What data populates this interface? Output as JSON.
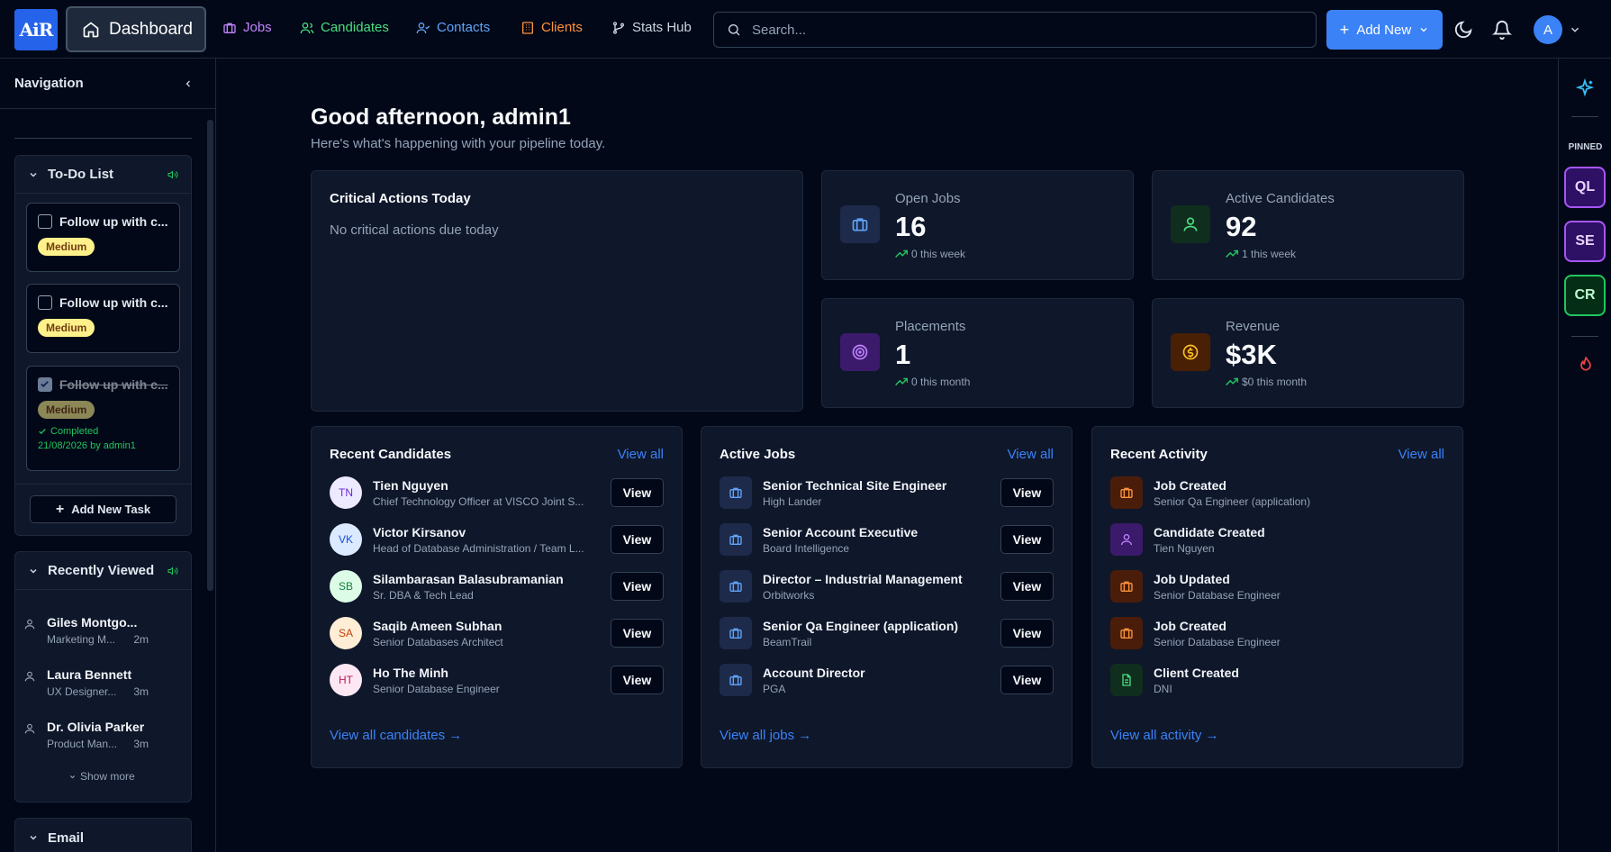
{
  "topbar": {
    "logo": "AiR",
    "dashboard": "Dashboard",
    "nav": [
      {
        "label": "Jobs",
        "color": "#c084fc"
      },
      {
        "label": "Candidates",
        "color": "#4ade80"
      },
      {
        "label": "Contacts",
        "color": "#60a5fa"
      },
      {
        "label": "Clients",
        "color": "#fb923c"
      },
      {
        "label": "Stats Hub",
        "color": "#cbd5e1"
      }
    ],
    "search_placeholder": "Search...",
    "add_new": "Add New",
    "avatar": "A"
  },
  "sidebar": {
    "title": "Navigation",
    "todo": {
      "title": "To-Do List",
      "items": [
        {
          "text": "Follow up with c...",
          "priority": "Medium"
        },
        {
          "text": "Follow up with c...",
          "priority": "Medium"
        },
        {
          "text": "Follow up with c...",
          "priority": "Medium",
          "status": "Completed",
          "completed_meta": "21/08/2026 by admin1"
        }
      ],
      "add_task": "Add New Task"
    },
    "recent": {
      "title": "Recently Viewed",
      "items": [
        {
          "name": "Giles Montgo...",
          "sub": "Marketing M...",
          "time": "2m"
        },
        {
          "name": "Laura Bennett",
          "sub": "UX Designer...",
          "time": "3m"
        },
        {
          "name": "Dr. Olivia Parker",
          "sub": "Product Man...",
          "time": "3m"
        }
      ],
      "show_more": "Show more"
    },
    "email": {
      "title": "Email"
    }
  },
  "main": {
    "greeting": "Good afternoon, admin1",
    "subtitle": "Here's what's happening with your pipeline today.",
    "critical": {
      "title": "Critical Actions Today",
      "empty": "No critical actions due today"
    },
    "stats": [
      {
        "label": "Open Jobs",
        "value": "16",
        "sub": "0 this week"
      },
      {
        "label": "Active Candidates",
        "value": "92",
        "sub": "1 this week"
      },
      {
        "label": "Placements",
        "value": "1",
        "sub": "0 this month"
      },
      {
        "label": "Revenue",
        "value": "$3K",
        "sub": "$0 this month"
      }
    ],
    "candidates": {
      "title": "Recent Candidates",
      "view_all": "View all",
      "footer": "View all candidates →",
      "button": "View",
      "items": [
        {
          "initials": "TN",
          "name": "Tien Nguyen",
          "desc": "Chief Technology Officer at VISCO Joint S..."
        },
        {
          "initials": "VK",
          "name": "Victor Kirsanov",
          "desc": "Head of Database Administration / Team L..."
        },
        {
          "initials": "SB",
          "name": "Silambarasan Balasubramanian",
          "desc": "Sr. DBA & Tech Lead"
        },
        {
          "initials": "SA",
          "name": "Saqib Ameen Subhan",
          "desc": "Senior Databases Architect"
        },
        {
          "initials": "HT",
          "name": "Ho The Minh",
          "desc": "Senior Database Engineer"
        }
      ]
    },
    "jobs": {
      "title": "Active Jobs",
      "view_all": "View all",
      "footer": "View all jobs →",
      "button": "View",
      "items": [
        {
          "name": "Senior Technical Site Engineer",
          "desc": "High Lander"
        },
        {
          "name": "Senior Account Executive",
          "desc": "Board Intelligence"
        },
        {
          "name": "Director – Industrial Management",
          "desc": "Orbitworks"
        },
        {
          "name": "Senior Qa Engineer (application)",
          "desc": "BeamTrail"
        },
        {
          "name": "Account Director",
          "desc": "PGA"
        }
      ]
    },
    "activity": {
      "title": "Recent Activity",
      "view_all": "View all",
      "footer": "View all activity →",
      "items": [
        {
          "name": "Job Created",
          "desc": "Senior Qa Engineer (application)"
        },
        {
          "name": "Candidate Created",
          "desc": "Tien Nguyen"
        },
        {
          "name": "Job Updated",
          "desc": "Senior Database Engineer"
        },
        {
          "name": "Job Created",
          "desc": "Senior Database Engineer"
        },
        {
          "name": "Client Created",
          "desc": "DNI"
        }
      ]
    }
  },
  "right_rail": {
    "pinned_label": "PINNED",
    "pins": [
      "QL",
      "SE",
      "CR"
    ]
  }
}
